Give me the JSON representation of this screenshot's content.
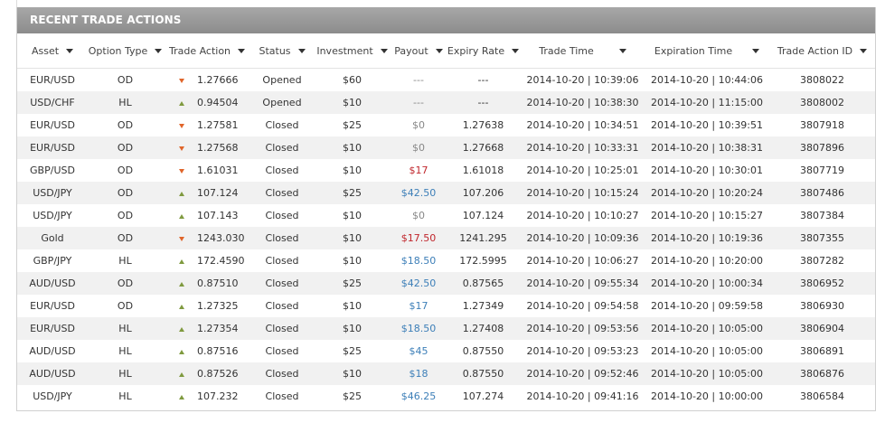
{
  "panel": {
    "title": "RECENT TRADE ACTIONS"
  },
  "colors": {
    "down_arrow": "#e0652a",
    "up_arrow": "#7f9a3f",
    "payout_red": "#c0262c",
    "payout_blue": "#3d7fb8",
    "header_bg": "#9a9a9a"
  },
  "columns": [
    "Asset",
    "Option Type",
    "Trade Action",
    "Status",
    "Investment",
    "Payout",
    "Expiry Rate",
    "Trade Time",
    "Expiration Time",
    "Trade Action ID"
  ],
  "rows": [
    {
      "asset": "EUR/USD",
      "type": "OD",
      "direction": "down",
      "action": "1.27666",
      "status": "Opened",
      "investment": "$60",
      "payout": "---",
      "payout_style": "gray",
      "expiry": "---",
      "trade_time": "2014-10-20 | 10:39:06",
      "expiration": "2014-10-20 | 10:44:06",
      "id": "3808022"
    },
    {
      "asset": "USD/CHF",
      "type": "HL",
      "direction": "up",
      "action": "0.94504",
      "status": "Opened",
      "investment": "$10",
      "payout": "---",
      "payout_style": "gray",
      "expiry": "---",
      "trade_time": "2014-10-20 | 10:38:30",
      "expiration": "2014-10-20 | 11:15:00",
      "id": "3808002"
    },
    {
      "asset": "EUR/USD",
      "type": "OD",
      "direction": "down",
      "action": "1.27581",
      "status": "Closed",
      "investment": "$25",
      "payout": "$0",
      "payout_style": "gray",
      "expiry": "1.27638",
      "trade_time": "2014-10-20 | 10:34:51",
      "expiration": "2014-10-20 | 10:39:51",
      "id": "3807918"
    },
    {
      "asset": "EUR/USD",
      "type": "OD",
      "direction": "down",
      "action": "1.27568",
      "status": "Closed",
      "investment": "$10",
      "payout": "$0",
      "payout_style": "gray",
      "expiry": "1.27668",
      "trade_time": "2014-10-20 | 10:33:31",
      "expiration": "2014-10-20 | 10:38:31",
      "id": "3807896"
    },
    {
      "asset": "GBP/USD",
      "type": "OD",
      "direction": "down",
      "action": "1.61031",
      "status": "Closed",
      "investment": "$10",
      "payout": "$17",
      "payout_style": "red",
      "expiry": "1.61018",
      "trade_time": "2014-10-20 | 10:25:01",
      "expiration": "2014-10-20 | 10:30:01",
      "id": "3807719"
    },
    {
      "asset": "USD/JPY",
      "type": "OD",
      "direction": "up",
      "action": "107.124",
      "status": "Closed",
      "investment": "$25",
      "payout": "$42.50",
      "payout_style": "blue",
      "expiry": "107.206",
      "trade_time": "2014-10-20 | 10:15:24",
      "expiration": "2014-10-20 | 10:20:24",
      "id": "3807486"
    },
    {
      "asset": "USD/JPY",
      "type": "OD",
      "direction": "up",
      "action": "107.143",
      "status": "Closed",
      "investment": "$10",
      "payout": "$0",
      "payout_style": "gray",
      "expiry": "107.124",
      "trade_time": "2014-10-20 | 10:10:27",
      "expiration": "2014-10-20 | 10:15:27",
      "id": "3807384"
    },
    {
      "asset": "Gold",
      "type": "OD",
      "direction": "down",
      "action": "1243.030",
      "status": "Closed",
      "investment": "$10",
      "payout": "$17.50",
      "payout_style": "red",
      "expiry": "1241.295",
      "trade_time": "2014-10-20 | 10:09:36",
      "expiration": "2014-10-20 | 10:19:36",
      "id": "3807355"
    },
    {
      "asset": "GBP/JPY",
      "type": "HL",
      "direction": "up",
      "action": "172.4590",
      "status": "Closed",
      "investment": "$10",
      "payout": "$18.50",
      "payout_style": "blue",
      "expiry": "172.5995",
      "trade_time": "2014-10-20 | 10:06:27",
      "expiration": "2014-10-20 | 10:20:00",
      "id": "3807282"
    },
    {
      "asset": "AUD/USD",
      "type": "OD",
      "direction": "up",
      "action": "0.87510",
      "status": "Closed",
      "investment": "$25",
      "payout": "$42.50",
      "payout_style": "blue",
      "expiry": "0.87565",
      "trade_time": "2014-10-20 | 09:55:34",
      "expiration": "2014-10-20 | 10:00:34",
      "id": "3806952"
    },
    {
      "asset": "EUR/USD",
      "type": "OD",
      "direction": "up",
      "action": "1.27325",
      "status": "Closed",
      "investment": "$10",
      "payout": "$17",
      "payout_style": "blue",
      "expiry": "1.27349",
      "trade_time": "2014-10-20 | 09:54:58",
      "expiration": "2014-10-20 | 09:59:58",
      "id": "3806930"
    },
    {
      "asset": "EUR/USD",
      "type": "HL",
      "direction": "up",
      "action": "1.27354",
      "status": "Closed",
      "investment": "$10",
      "payout": "$18.50",
      "payout_style": "blue",
      "expiry": "1.27408",
      "trade_time": "2014-10-20 | 09:53:56",
      "expiration": "2014-10-20 | 10:05:00",
      "id": "3806904"
    },
    {
      "asset": "AUD/USD",
      "type": "HL",
      "direction": "up",
      "action": "0.87516",
      "status": "Closed",
      "investment": "$25",
      "payout": "$45",
      "payout_style": "blue",
      "expiry": "0.87550",
      "trade_time": "2014-10-20 | 09:53:23",
      "expiration": "2014-10-20 | 10:05:00",
      "id": "3806891"
    },
    {
      "asset": "AUD/USD",
      "type": "HL",
      "direction": "up",
      "action": "0.87526",
      "status": "Closed",
      "investment": "$10",
      "payout": "$18",
      "payout_style": "blue",
      "expiry": "0.87550",
      "trade_time": "2014-10-20 | 09:52:46",
      "expiration": "2014-10-20 | 10:05:00",
      "id": "3806876"
    },
    {
      "asset": "USD/JPY",
      "type": "HL",
      "direction": "up",
      "action": "107.232",
      "status": "Closed",
      "investment": "$25",
      "payout": "$46.25",
      "payout_style": "blue",
      "expiry": "107.274",
      "trade_time": "2014-10-20 | 09:41:16",
      "expiration": "2014-10-20 | 10:00:00",
      "id": "3806584"
    }
  ]
}
